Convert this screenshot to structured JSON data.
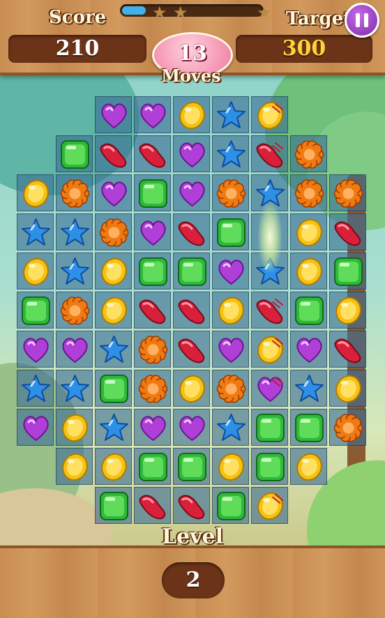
{
  "hud": {
    "score_label": "Score",
    "score_value": "210",
    "target_label": "Target",
    "target_value": "300",
    "moves_value": "13",
    "moves_label": "Moves",
    "level_label": "Level",
    "level_value": "2",
    "progress_fraction": 0.17,
    "stars": [
      "star-icon",
      "star-icon",
      "star-icon"
    ],
    "pause_icon": "pause-icon"
  },
  "colors": {
    "purple": "#b03fd8",
    "green": "#2fb83a",
    "yellow": "#f5c214",
    "blue": "#2e8fe6",
    "red": "#d9203a",
    "orange": "#f07a12",
    "wood": "#c98d52",
    "panel": "#6b3418"
  },
  "candy_legend": {
    "P": "purple-heart-candy",
    "G": "green-square-candy",
    "Y": "yellow-round-candy",
    "B": "blue-star-candy",
    "R": "red-bean-candy",
    "O": "orange-flower-candy"
  },
  "board": {
    "rows": [
      [
        "",
        "",
        "P",
        "P",
        "Y",
        "B",
        "Ys",
        "",
        ""
      ],
      [
        "",
        "G",
        "R",
        "R",
        "P",
        "B",
        "Rs",
        "O",
        ""
      ],
      [
        "Y",
        "O",
        "P",
        "G",
        "P",
        "O",
        "B",
        "O",
        "O"
      ],
      [
        "B",
        "B",
        "O",
        "P",
        "R",
        "G",
        "",
        "Y",
        "R"
      ],
      [
        "Y",
        "B",
        "Y",
        "G",
        "G",
        "P",
        "B",
        "Y",
        "G"
      ],
      [
        "G",
        "O",
        "Y",
        "R",
        "R",
        "Y",
        "Rs",
        "G",
        "Y"
      ],
      [
        "P",
        "P",
        "B",
        "O",
        "R",
        "P",
        "Ys",
        "P",
        "R"
      ],
      [
        "B",
        "B",
        "G",
        "O",
        "Y",
        "O",
        "Ps",
        "B",
        "Y"
      ],
      [
        "P",
        "Y",
        "B",
        "P",
        "P",
        "B",
        "G",
        "G",
        "O"
      ],
      [
        "",
        "Y",
        "Y",
        "G",
        "G",
        "Y",
        "G",
        "Y",
        ""
      ],
      [
        "",
        "",
        "G",
        "R",
        "R",
        "G",
        "Ys",
        "",
        ""
      ]
    ],
    "row_spans": [
      [
        2,
        7
      ],
      [
        1,
        8
      ],
      [
        0,
        9
      ],
      [
        0,
        9
      ],
      [
        0,
        9
      ],
      [
        0,
        9
      ],
      [
        0,
        9
      ],
      [
        0,
        9
      ],
      [
        0,
        9
      ],
      [
        1,
        8
      ],
      [
        2,
        7
      ]
    ]
  }
}
